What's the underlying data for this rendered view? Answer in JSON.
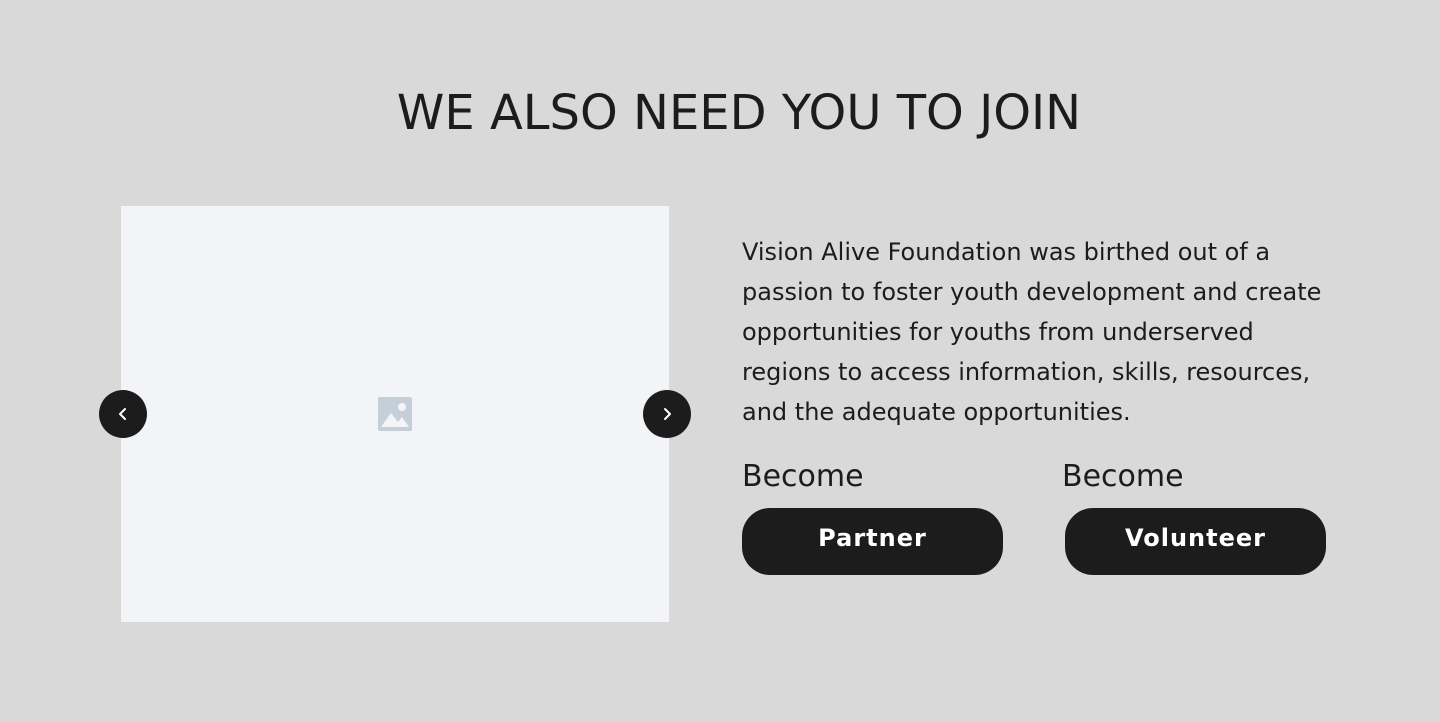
{
  "section": {
    "title": "WE ALSO NEED YOU TO JOIN",
    "description": "Vision Alive Foundation was birthed out of a passion to foster youth development and create opportunities for youths from underserved regions to access information, skills, resources, and the adequate opportunities."
  },
  "slider": {
    "image_icon": "image-placeholder-icon",
    "prev_icon": "chevron-left-icon",
    "next_icon": "chevron-right-icon"
  },
  "cta": [
    {
      "label": "Become",
      "button": "Partner"
    },
    {
      "label": "Become",
      "button": "Volunteer"
    }
  ],
  "colors": {
    "background": "#d9d9d9",
    "dark": "#1c1c1c",
    "image_bg": "#f2f4f8",
    "icon": "#c5cfd8"
  }
}
